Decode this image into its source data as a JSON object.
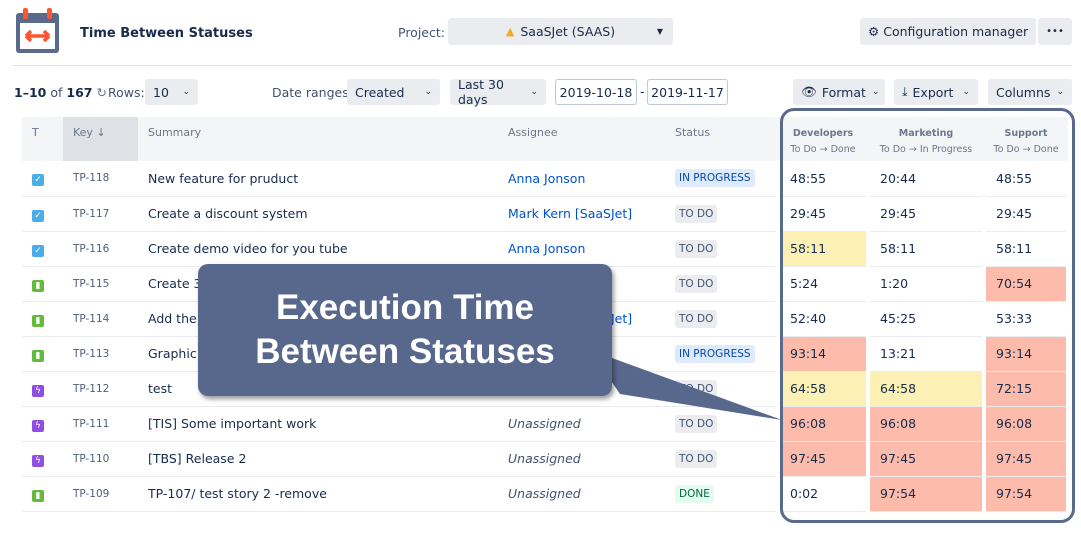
{
  "header": {
    "title": "Time Between Statuses",
    "project_label": "Project:",
    "project_value": "SaaSJet (SAAS)",
    "config_button": "Configuration manager",
    "more_button": "•••"
  },
  "toolbar": {
    "range_start": "1–10",
    "of": "of",
    "total": "167",
    "rows_label": "Rows:",
    "rows_value": "10",
    "date_ranges_label": "Date ranges:",
    "date_field": "Created",
    "period": "Last 30 days",
    "date_from": "2019-10-18",
    "date_sep": "-",
    "date_to": "2019-11-17",
    "format": "Format",
    "export": "Export",
    "columns": "Columns"
  },
  "table": {
    "headers": {
      "type": "T",
      "key": "Key ↓",
      "summary": "Summary",
      "assignee": "Assignee",
      "status": "Status"
    },
    "time_columns": [
      {
        "team": "Developers",
        "transition": "To Do → Done"
      },
      {
        "team": "Marketing",
        "transition": "To Do → In Progress"
      },
      {
        "team": "Support",
        "transition": "To Do → Done"
      }
    ],
    "rows": [
      {
        "type": "task",
        "key": "TP-118",
        "summary": "New feature for pruduct",
        "assignee": "Anna Jonson",
        "assigned": true,
        "status": "IN PROGRESS",
        "times": [
          "48:55",
          "20:44",
          "48:55"
        ],
        "levels": [
          "",
          "",
          ""
        ]
      },
      {
        "type": "task",
        "key": "TP-117",
        "summary": "Create a discount system",
        "assignee": "Mark Kern [SaaSJet]",
        "assigned": true,
        "status": "TO DO",
        "times": [
          "29:45",
          "29:45",
          "29:45"
        ],
        "levels": [
          "",
          "",
          ""
        ]
      },
      {
        "type": "task",
        "key": "TP-116",
        "summary": "Create demo video for you tube",
        "assignee": "Anna Jonson",
        "assigned": true,
        "status": "TO DO",
        "times": [
          "58:11",
          "58:11",
          "58:11"
        ],
        "levels": [
          "warn",
          "",
          ""
        ]
      },
      {
        "type": "story",
        "key": "TP-115",
        "summary": "Create 3",
        "assignee": "",
        "assigned": true,
        "status": "TO DO",
        "times": [
          "5:24",
          "1:20",
          "70:54"
        ],
        "levels": [
          "",
          "",
          "alert"
        ]
      },
      {
        "type": "story",
        "key": "TP-114",
        "summary": "Add the",
        "assignee": "Mark Kern [SaaSJet]",
        "assigned": true,
        "status": "TO DO",
        "times": [
          "52:40",
          "45:25",
          "53:33"
        ],
        "levels": [
          "",
          "",
          ""
        ]
      },
      {
        "type": "story",
        "key": "TP-113",
        "summary": "Graphic",
        "assignee": "",
        "assigned": true,
        "status": "IN PROGRESS",
        "times": [
          "93:14",
          "13:21",
          "93:14"
        ],
        "levels": [
          "alert",
          "",
          "alert"
        ]
      },
      {
        "type": "epic",
        "key": "TP-112",
        "summary": "test",
        "assignee": "",
        "assigned": true,
        "status": "TO DO",
        "times": [
          "64:58",
          "64:58",
          "72:15"
        ],
        "levels": [
          "warn",
          "warn",
          "alert"
        ]
      },
      {
        "type": "epic",
        "key": "TP-111",
        "summary": "[TIS] Some important work",
        "assignee": "Unassigned",
        "assigned": false,
        "status": "TO DO",
        "times": [
          "96:08",
          "96:08",
          "96:08"
        ],
        "levels": [
          "alert",
          "alert",
          "alert"
        ]
      },
      {
        "type": "epic",
        "key": "TP-110",
        "summary": "[TBS] Release 2",
        "assignee": "Unassigned",
        "assigned": false,
        "status": "TO DO",
        "times": [
          "97:45",
          "97:45",
          "97:45"
        ],
        "levels": [
          "alert",
          "alert",
          "alert"
        ]
      },
      {
        "type": "story",
        "key": "TP-109",
        "summary": "TP-107/ test story 2 -remove",
        "assignee": "Unassigned",
        "assigned": false,
        "status": "DONE",
        "times": [
          "0:02",
          "97:54",
          "97:54"
        ],
        "levels": [
          "",
          "alert",
          "alert"
        ]
      }
    ]
  },
  "callout": {
    "line1": "Execution Time",
    "line2": "Between Statuses"
  },
  "colors": {
    "warn": "#fdf0b5",
    "alert": "#fdbcab",
    "task": "#4bade8",
    "story": "#63ba3c",
    "epic": "#904ee2",
    "accent": "#58688c"
  }
}
